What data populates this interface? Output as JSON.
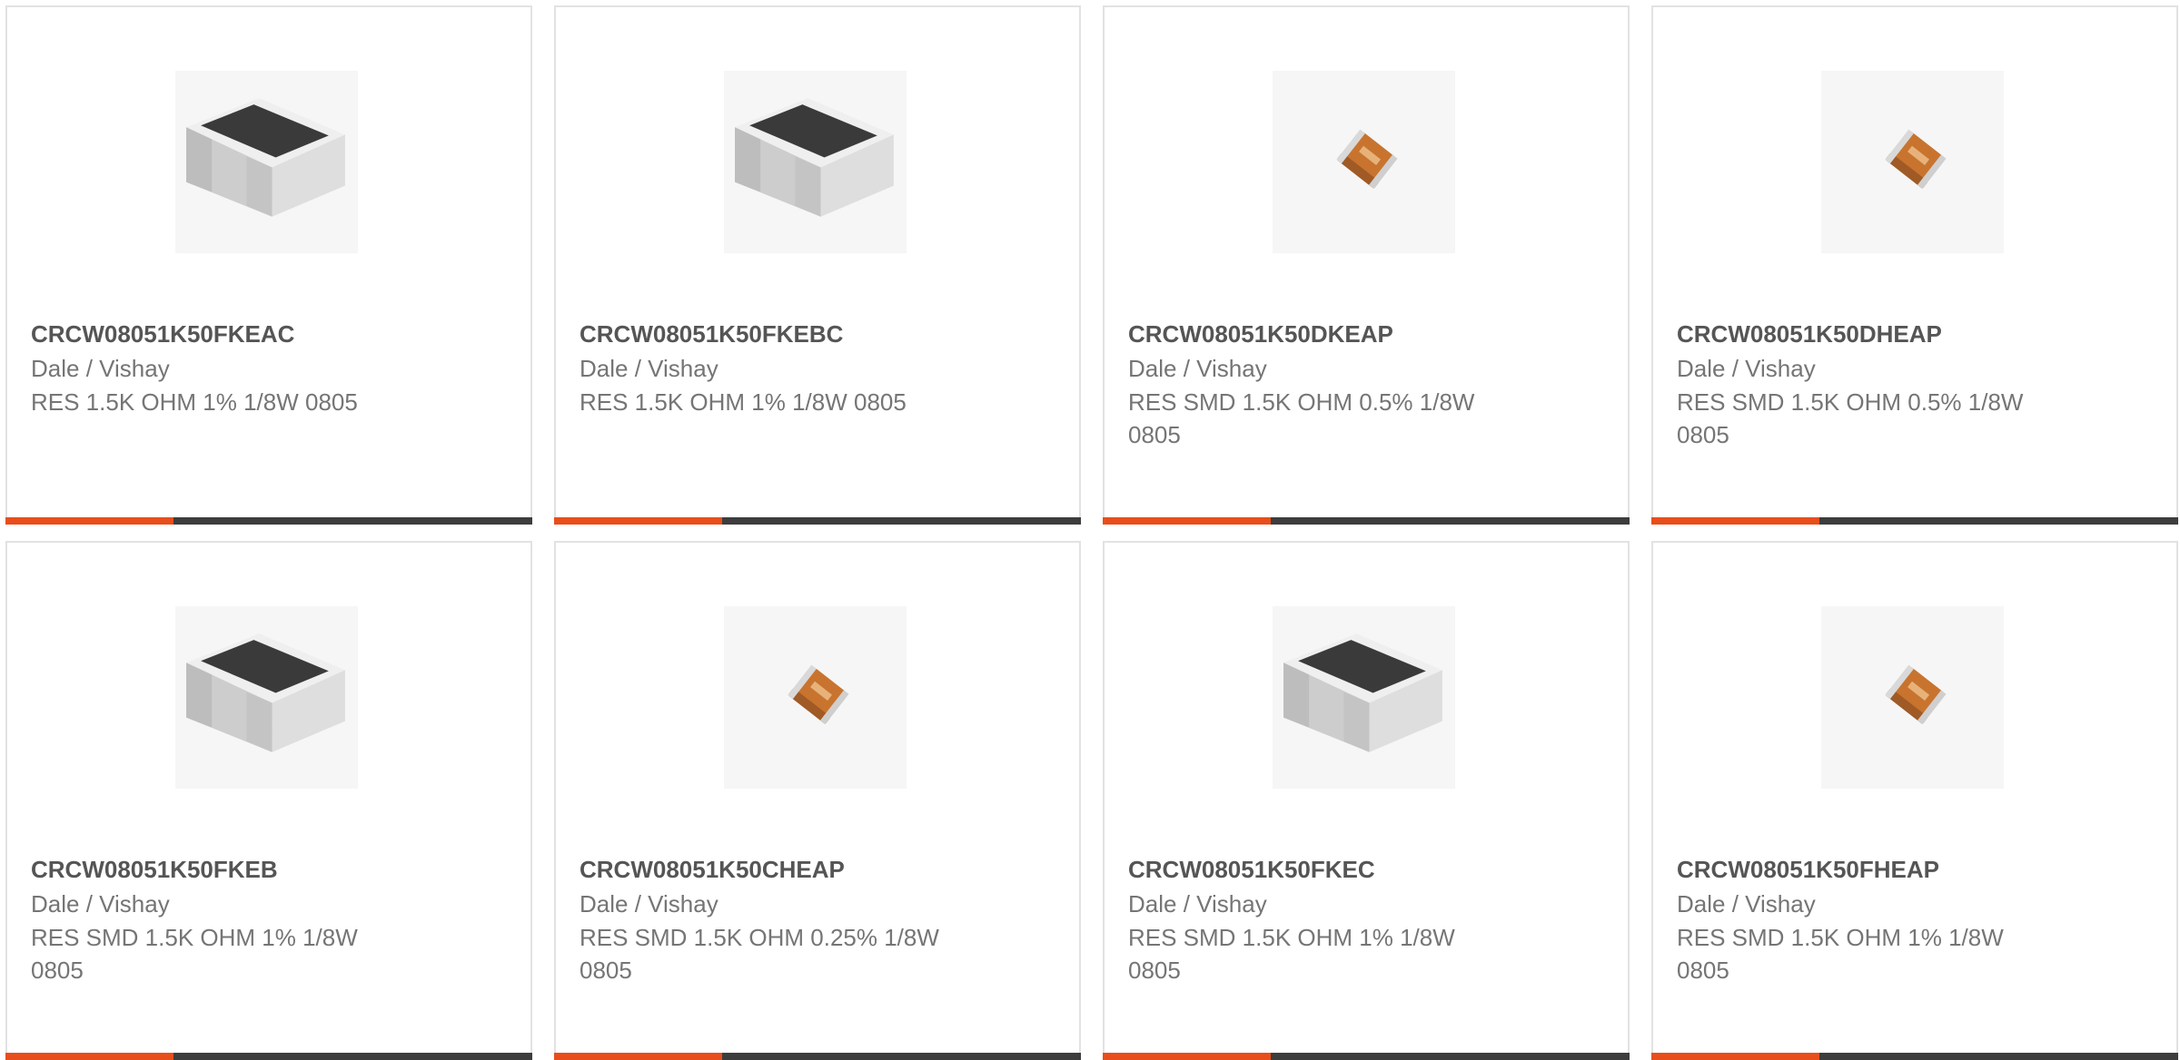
{
  "accent_color": "#e84e1b",
  "cards": [
    {
      "part_number": "CRCW08051K50FKEAC",
      "manufacturer": "Dale / Vishay",
      "description": "RES 1.5K OHM 1% 1/8W 0805",
      "image": "large-chip-resistor"
    },
    {
      "part_number": "CRCW08051K50FKEBC",
      "manufacturer": "Dale / Vishay",
      "description": "RES 1.5K OHM 1% 1/8W 0805",
      "image": "large-chip-resistor"
    },
    {
      "part_number": "CRCW08051K50DKEAP",
      "manufacturer": "Dale / Vishay",
      "description": "RES SMD 1.5K OHM 0.5% 1/8W 0805",
      "image": "small-orange-chip-resistor"
    },
    {
      "part_number": "CRCW08051K50DHEAP",
      "manufacturer": "Dale / Vishay",
      "description": "RES SMD 1.5K OHM 0.5% 1/8W 0805",
      "image": "small-orange-chip-resistor"
    },
    {
      "part_number": "CRCW08051K50FKEB",
      "manufacturer": "Dale / Vishay",
      "description": "RES SMD 1.5K OHM 1% 1/8W 0805",
      "image": "large-chip-resistor"
    },
    {
      "part_number": "CRCW08051K50CHEAP",
      "manufacturer": "Dale / Vishay",
      "description": "RES SMD 1.5K OHM 0.25% 1/8W 0805",
      "image": "small-orange-chip-resistor"
    },
    {
      "part_number": "CRCW08051K50FKEC",
      "manufacturer": "Dale / Vishay",
      "description": "RES SMD 1.5K OHM 1% 1/8W 0805",
      "image": "large-chip-resistor"
    },
    {
      "part_number": "CRCW08051K50FHEAP",
      "manufacturer": "Dale / Vishay",
      "description": "RES SMD 1.5K OHM 1% 1/8W 0805",
      "image": "small-orange-chip-resistor"
    }
  ]
}
